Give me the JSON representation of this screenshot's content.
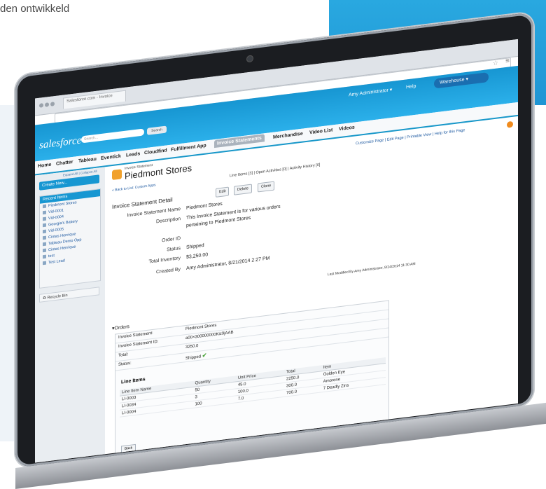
{
  "caption": "den ontwikkeld",
  "browser": {
    "tab_label": "Salesforce.com - Invoice"
  },
  "header": {
    "logo": "salesforce",
    "search_placeholder": "Search...",
    "search_button": "Search",
    "user": "Amy Administrator",
    "help": "Help",
    "app": "Warehouse"
  },
  "tabs": [
    "Home",
    "Chatter",
    "Tableau",
    "Eventick",
    "Leads",
    "Cloudfind",
    "Fulfillment App",
    "Invoice Statements",
    "Merchandise",
    "Video List",
    "Videos"
  ],
  "sidebar": {
    "expand": "Expand All | Collapse All",
    "create_new": "Create New...",
    "recent_title": "Recent Items",
    "recent_items": [
      "Piedmont Stores",
      "Vid-0001",
      "Vid-0004",
      "Georgia's Bakery",
      "Vid-0005",
      "Cintas Henrique",
      "Tableau Demo Opp",
      "Cintas Henrique",
      "test",
      "Test Lead"
    ],
    "recycle": "Recycle Bin"
  },
  "record": {
    "type": "Invoice Statement",
    "title": "Piedmont Stores",
    "page_links": "Customize Page | Edit Page | Printable View | Help for this Page",
    "back_link": "« Back to List: Custom Apps",
    "related": "Line Items [3]  |  Open Activities [0]  |  Activity History [0]",
    "detail_title": "Invoice Statement Detail",
    "buttons": [
      "Edit",
      "Delete",
      "Clone"
    ],
    "fields": [
      {
        "label": "Invoice Statement Name",
        "value": "Piedmont Stores"
      },
      {
        "label": "Description",
        "value": "This Invoice Statement is for various orders"
      },
      {
        "label": "",
        "value": "pertaining to Piedmont Stores"
      },
      {
        "label": "Order ID",
        "value": ""
      },
      {
        "label": "Status",
        "value": "Shipped"
      },
      {
        "label": "Total Inventory",
        "value": "$3,250.00"
      },
      {
        "label": "Created By",
        "value": "Amy Administrator, 8/21/2014 2:27 PM"
      }
    ],
    "last_modified": "Last Modified By   Amy Administrator, 8/24/2014 11:30 AM"
  },
  "orders": {
    "heading": "Orders",
    "fields": [
      {
        "label": "Invoice Statement:",
        "value": "Piedmont Stores"
      },
      {
        "label": "Invoice Statement ID:",
        "value": "a00×300000000Kiz9jAAB"
      },
      {
        "label": "Total:",
        "value": "3250.0"
      },
      {
        "label": "Status:",
        "value": "Shipped"
      }
    ],
    "line_items_title": "Line Items",
    "columns": [
      "Line Item Name",
      "Quantity",
      "Unit Price",
      "Total",
      "Item"
    ],
    "rows": [
      [
        "LI-0003",
        "50",
        "45.0",
        "2250.0",
        "Golden Eye"
      ],
      [
        "LI-0034",
        "3",
        "100.0",
        "300.0",
        "Amorone"
      ],
      [
        "LI-0004",
        "100",
        "7.0",
        "700.0",
        "7 Deadly Zins"
      ]
    ],
    "back_button": "Back"
  }
}
